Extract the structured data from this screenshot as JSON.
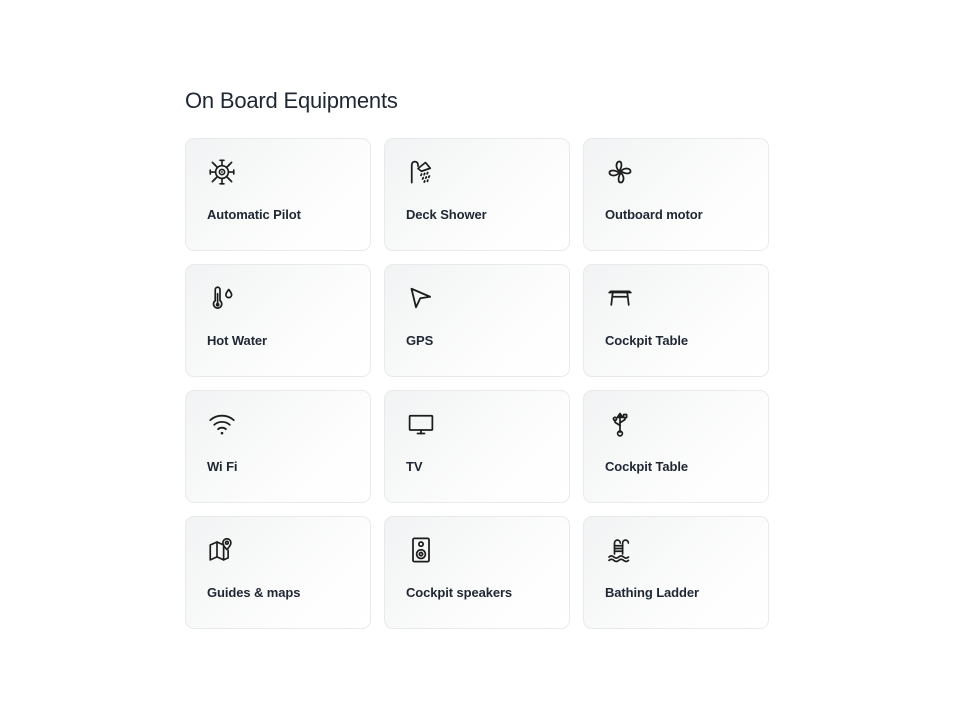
{
  "section": {
    "title": "On Board Equipments",
    "accent_color": "#1f2733",
    "card_border_color": "#e9eaec",
    "icon_color": "#1c1c1c"
  },
  "equipments": [
    {
      "label": "Automatic Pilot",
      "icon": "ship-wheel-icon"
    },
    {
      "label": "Deck Shower",
      "icon": "shower-icon"
    },
    {
      "label": "Outboard motor",
      "icon": "propeller-icon"
    },
    {
      "label": "Hot Water",
      "icon": "thermometer-droplet-icon"
    },
    {
      "label": "GPS",
      "icon": "navigation-arrow-icon"
    },
    {
      "label": "Cockpit Table",
      "icon": "table-icon"
    },
    {
      "label": "Wi Fi",
      "icon": "wifi-icon"
    },
    {
      "label": "TV",
      "icon": "television-icon"
    },
    {
      "label": "Cockpit Table",
      "icon": "usb-icon"
    },
    {
      "label": "Guides & maps",
      "icon": "map-pin-icon"
    },
    {
      "label": "Cockpit speakers",
      "icon": "speaker-icon"
    },
    {
      "label": "Bathing Ladder",
      "icon": "pool-ladder-icon"
    }
  ]
}
